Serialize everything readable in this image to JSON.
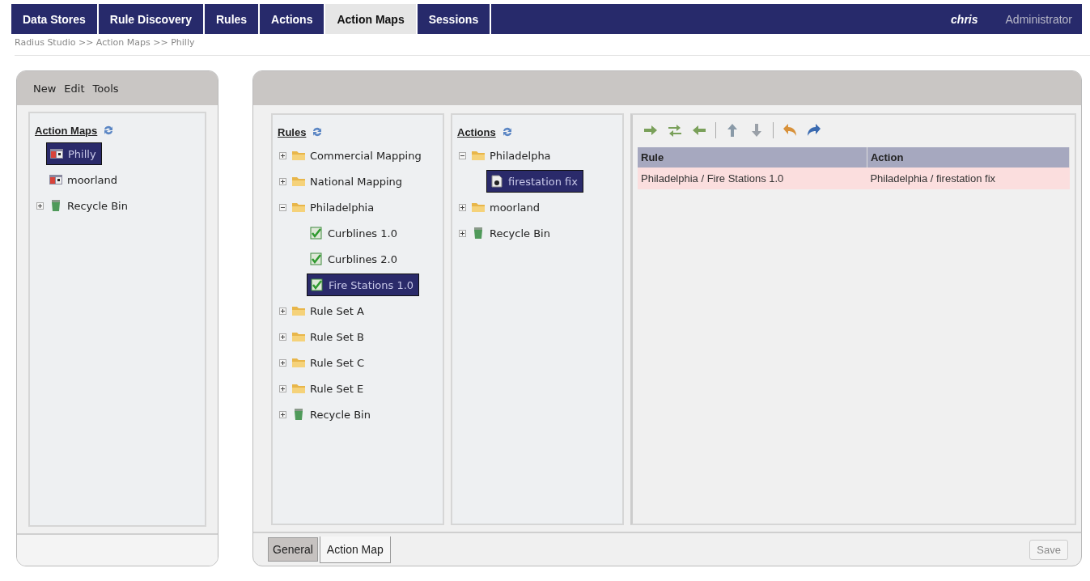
{
  "nav": {
    "tabs": [
      {
        "label": "Data Stores",
        "selected": false
      },
      {
        "label": "Rule Discovery",
        "selected": false
      },
      {
        "label": "Rules",
        "selected": false
      },
      {
        "label": "Actions",
        "selected": false
      },
      {
        "label": "Action Maps",
        "selected": true
      },
      {
        "label": "Sessions",
        "selected": false
      }
    ],
    "user": "chris",
    "role": "Administrator"
  },
  "breadcrumb": "Radius Studio >> Action Maps >> Philly",
  "left_panel": {
    "menu": [
      "New",
      "Edit",
      "Tools"
    ],
    "tree": {
      "title": "Action Maps",
      "items": [
        {
          "label": "Philly",
          "kind": "map",
          "selected": true
        },
        {
          "label": "moorland",
          "kind": "map",
          "selected": false
        },
        {
          "label": "Recycle Bin",
          "kind": "recycle",
          "expanded": false,
          "selected": false
        }
      ]
    }
  },
  "rules": {
    "title": "Rules",
    "items": [
      {
        "label": "Commercial Mapping",
        "kind": "folder",
        "expanded": false,
        "selected": false
      },
      {
        "label": "National Mapping",
        "kind": "folder",
        "expanded": false,
        "selected": false
      },
      {
        "label": "Philadelphia",
        "kind": "folder",
        "expanded": true,
        "selected": false,
        "children": [
          {
            "label": "Curblines 1.0",
            "kind": "rule",
            "selected": false
          },
          {
            "label": "Curblines 2.0",
            "kind": "rule",
            "selected": false
          },
          {
            "label": "Fire Stations 1.0",
            "kind": "rule",
            "selected": true
          }
        ]
      },
      {
        "label": "Rule Set A",
        "kind": "folder",
        "expanded": false,
        "selected": false
      },
      {
        "label": "Rule Set B",
        "kind": "folder",
        "expanded": false,
        "selected": false
      },
      {
        "label": "Rule Set C",
        "kind": "folder",
        "expanded": false,
        "selected": false
      },
      {
        "label": "Rule Set E",
        "kind": "folder",
        "expanded": false,
        "selected": false
      },
      {
        "label": "Recycle Bin",
        "kind": "recycle",
        "expanded": false,
        "selected": false
      }
    ]
  },
  "actions": {
    "title": "Actions",
    "items": [
      {
        "label": "Philadelpha",
        "kind": "folder",
        "expanded": true,
        "selected": false,
        "children": [
          {
            "label": "firestation fix",
            "kind": "action",
            "selected": true
          }
        ]
      },
      {
        "label": "moorland",
        "kind": "folder",
        "expanded": false,
        "selected": false
      },
      {
        "label": "Recycle Bin",
        "kind": "recycle",
        "expanded": false,
        "selected": false
      }
    ]
  },
  "mapping_table": {
    "columns": [
      "Rule",
      "Action"
    ],
    "rows": [
      {
        "cells": [
          "Philadelphia / Fire Stations 1.0",
          "Philadelphia / firestation fix"
        ]
      }
    ]
  },
  "bottom_tabs": [
    {
      "label": "General",
      "selected": false
    },
    {
      "label": "Action Map",
      "selected": true
    }
  ],
  "save_button": {
    "label": "Save",
    "disabled": true
  }
}
